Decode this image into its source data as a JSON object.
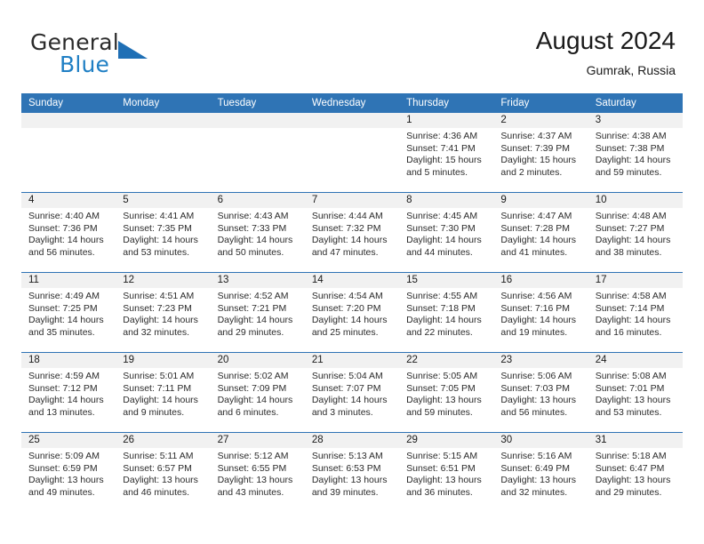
{
  "brand": {
    "name_part1": "General",
    "name_part2": "Blue",
    "logo_icon": "triangle-logo-icon"
  },
  "header": {
    "title": "August 2024",
    "location": "Gumrak, Russia"
  },
  "colors": {
    "header_blue": "#2F74B5",
    "row_divider_blue": "#2F74B5",
    "date_strip_gray": "#F1F1F1",
    "brand_blue": "#1F7FC4",
    "text": "#2B2B2B"
  },
  "weekdays": [
    "Sunday",
    "Monday",
    "Tuesday",
    "Wednesday",
    "Thursday",
    "Friday",
    "Saturday"
  ],
  "weeks": [
    {
      "numbers": [
        "",
        "",
        "",
        "",
        "1",
        "2",
        "3"
      ],
      "cells": [
        {
          "sunrise": "",
          "sunset": "",
          "daylight": ""
        },
        {
          "sunrise": "",
          "sunset": "",
          "daylight": ""
        },
        {
          "sunrise": "",
          "sunset": "",
          "daylight": ""
        },
        {
          "sunrise": "",
          "sunset": "",
          "daylight": ""
        },
        {
          "sunrise": "Sunrise: 4:36 AM",
          "sunset": "Sunset: 7:41 PM",
          "daylight": "Daylight: 15 hours and 5 minutes."
        },
        {
          "sunrise": "Sunrise: 4:37 AM",
          "sunset": "Sunset: 7:39 PM",
          "daylight": "Daylight: 15 hours and 2 minutes."
        },
        {
          "sunrise": "Sunrise: 4:38 AM",
          "sunset": "Sunset: 7:38 PM",
          "daylight": "Daylight: 14 hours and 59 minutes."
        }
      ]
    },
    {
      "numbers": [
        "4",
        "5",
        "6",
        "7",
        "8",
        "9",
        "10"
      ],
      "cells": [
        {
          "sunrise": "Sunrise: 4:40 AM",
          "sunset": "Sunset: 7:36 PM",
          "daylight": "Daylight: 14 hours and 56 minutes."
        },
        {
          "sunrise": "Sunrise: 4:41 AM",
          "sunset": "Sunset: 7:35 PM",
          "daylight": "Daylight: 14 hours and 53 minutes."
        },
        {
          "sunrise": "Sunrise: 4:43 AM",
          "sunset": "Sunset: 7:33 PM",
          "daylight": "Daylight: 14 hours and 50 minutes."
        },
        {
          "sunrise": "Sunrise: 4:44 AM",
          "sunset": "Sunset: 7:32 PM",
          "daylight": "Daylight: 14 hours and 47 minutes."
        },
        {
          "sunrise": "Sunrise: 4:45 AM",
          "sunset": "Sunset: 7:30 PM",
          "daylight": "Daylight: 14 hours and 44 minutes."
        },
        {
          "sunrise": "Sunrise: 4:47 AM",
          "sunset": "Sunset: 7:28 PM",
          "daylight": "Daylight: 14 hours and 41 minutes."
        },
        {
          "sunrise": "Sunrise: 4:48 AM",
          "sunset": "Sunset: 7:27 PM",
          "daylight": "Daylight: 14 hours and 38 minutes."
        }
      ]
    },
    {
      "numbers": [
        "11",
        "12",
        "13",
        "14",
        "15",
        "16",
        "17"
      ],
      "cells": [
        {
          "sunrise": "Sunrise: 4:49 AM",
          "sunset": "Sunset: 7:25 PM",
          "daylight": "Daylight: 14 hours and 35 minutes."
        },
        {
          "sunrise": "Sunrise: 4:51 AM",
          "sunset": "Sunset: 7:23 PM",
          "daylight": "Daylight: 14 hours and 32 minutes."
        },
        {
          "sunrise": "Sunrise: 4:52 AM",
          "sunset": "Sunset: 7:21 PM",
          "daylight": "Daylight: 14 hours and 29 minutes."
        },
        {
          "sunrise": "Sunrise: 4:54 AM",
          "sunset": "Sunset: 7:20 PM",
          "daylight": "Daylight: 14 hours and 25 minutes."
        },
        {
          "sunrise": "Sunrise: 4:55 AM",
          "sunset": "Sunset: 7:18 PM",
          "daylight": "Daylight: 14 hours and 22 minutes."
        },
        {
          "sunrise": "Sunrise: 4:56 AM",
          "sunset": "Sunset: 7:16 PM",
          "daylight": "Daylight: 14 hours and 19 minutes."
        },
        {
          "sunrise": "Sunrise: 4:58 AM",
          "sunset": "Sunset: 7:14 PM",
          "daylight": "Daylight: 14 hours and 16 minutes."
        }
      ]
    },
    {
      "numbers": [
        "18",
        "19",
        "20",
        "21",
        "22",
        "23",
        "24"
      ],
      "cells": [
        {
          "sunrise": "Sunrise: 4:59 AM",
          "sunset": "Sunset: 7:12 PM",
          "daylight": "Daylight: 14 hours and 13 minutes."
        },
        {
          "sunrise": "Sunrise: 5:01 AM",
          "sunset": "Sunset: 7:11 PM",
          "daylight": "Daylight: 14 hours and 9 minutes."
        },
        {
          "sunrise": "Sunrise: 5:02 AM",
          "sunset": "Sunset: 7:09 PM",
          "daylight": "Daylight: 14 hours and 6 minutes."
        },
        {
          "sunrise": "Sunrise: 5:04 AM",
          "sunset": "Sunset: 7:07 PM",
          "daylight": "Daylight: 14 hours and 3 minutes."
        },
        {
          "sunrise": "Sunrise: 5:05 AM",
          "sunset": "Sunset: 7:05 PM",
          "daylight": "Daylight: 13 hours and 59 minutes."
        },
        {
          "sunrise": "Sunrise: 5:06 AM",
          "sunset": "Sunset: 7:03 PM",
          "daylight": "Daylight: 13 hours and 56 minutes."
        },
        {
          "sunrise": "Sunrise: 5:08 AM",
          "sunset": "Sunset: 7:01 PM",
          "daylight": "Daylight: 13 hours and 53 minutes."
        }
      ]
    },
    {
      "numbers": [
        "25",
        "26",
        "27",
        "28",
        "29",
        "30",
        "31"
      ],
      "cells": [
        {
          "sunrise": "Sunrise: 5:09 AM",
          "sunset": "Sunset: 6:59 PM",
          "daylight": "Daylight: 13 hours and 49 minutes."
        },
        {
          "sunrise": "Sunrise: 5:11 AM",
          "sunset": "Sunset: 6:57 PM",
          "daylight": "Daylight: 13 hours and 46 minutes."
        },
        {
          "sunrise": "Sunrise: 5:12 AM",
          "sunset": "Sunset: 6:55 PM",
          "daylight": "Daylight: 13 hours and 43 minutes."
        },
        {
          "sunrise": "Sunrise: 5:13 AM",
          "sunset": "Sunset: 6:53 PM",
          "daylight": "Daylight: 13 hours and 39 minutes."
        },
        {
          "sunrise": "Sunrise: 5:15 AM",
          "sunset": "Sunset: 6:51 PM",
          "daylight": "Daylight: 13 hours and 36 minutes."
        },
        {
          "sunrise": "Sunrise: 5:16 AM",
          "sunset": "Sunset: 6:49 PM",
          "daylight": "Daylight: 13 hours and 32 minutes."
        },
        {
          "sunrise": "Sunrise: 5:18 AM",
          "sunset": "Sunset: 6:47 PM",
          "daylight": "Daylight: 13 hours and 29 minutes."
        }
      ]
    }
  ]
}
